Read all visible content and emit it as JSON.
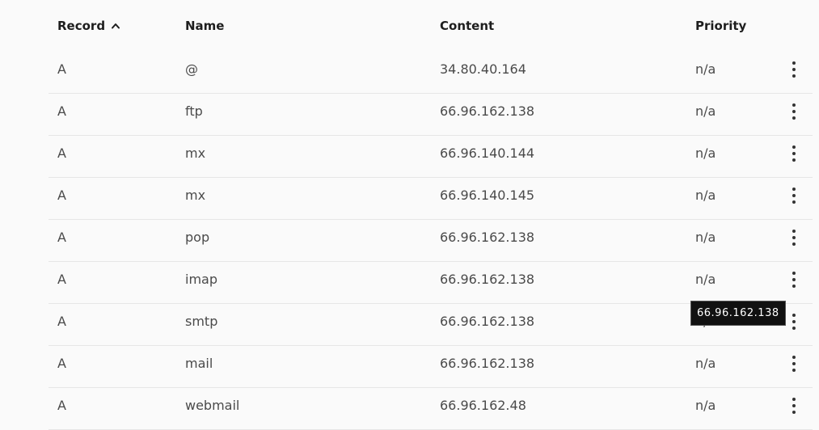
{
  "header": {
    "record": "Record",
    "name": "Name",
    "content": "Content",
    "priority": "Priority"
  },
  "rows": [
    {
      "record": "A",
      "name": "@",
      "content": "34.80.40.164",
      "priority": "n/a"
    },
    {
      "record": "A",
      "name": "ftp",
      "content": "66.96.162.138",
      "priority": "n/a"
    },
    {
      "record": "A",
      "name": "mx",
      "content": "66.96.140.144",
      "priority": "n/a"
    },
    {
      "record": "A",
      "name": "mx",
      "content": "66.96.140.145",
      "priority": "n/a"
    },
    {
      "record": "A",
      "name": "pop",
      "content": "66.96.162.138",
      "priority": "n/a"
    },
    {
      "record": "A",
      "name": "imap",
      "content": "66.96.162.138",
      "priority": "n/a"
    },
    {
      "record": "A",
      "name": "smtp",
      "content": "66.96.162.138",
      "priority": "n/a"
    },
    {
      "record": "A",
      "name": "mail",
      "content": "66.96.162.138",
      "priority": "n/a"
    },
    {
      "record": "A",
      "name": "webmail",
      "content": "66.96.162.48",
      "priority": "n/a"
    }
  ],
  "tooltip": {
    "text": "66.96.162.138"
  },
  "icons": {
    "sort": "chevron-up-icon",
    "row_menu": "more-vertical-icon"
  }
}
